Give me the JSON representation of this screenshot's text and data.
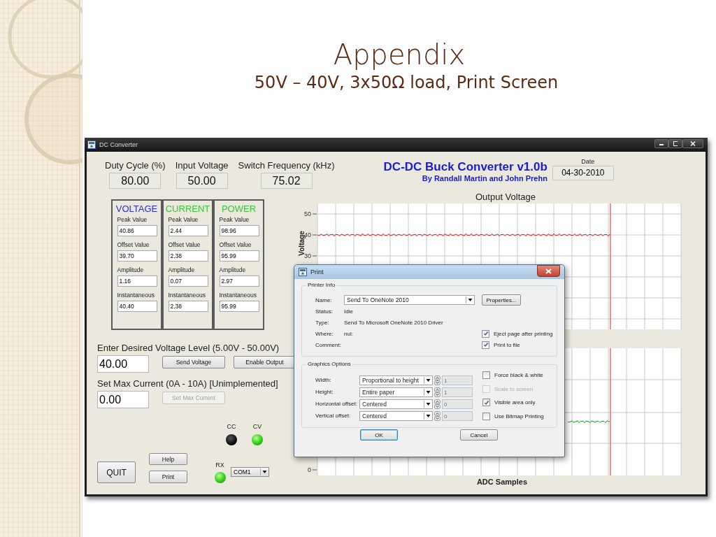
{
  "slide": {
    "title": "Appendix",
    "subtitle": "50V – 40V, 3x50Ω load, Print Screen"
  },
  "window": {
    "title": "DC Converter"
  },
  "readouts": [
    {
      "label": "Duty Cycle (%)",
      "value": "80.00"
    },
    {
      "label": "Input Voltage",
      "value": "50.00"
    },
    {
      "label": "Switch Frequency (kHz)",
      "value": "75.02"
    }
  ],
  "header": {
    "title": "DC-DC Buck Converter v1.0b",
    "authors": "By Randall Martin and John Prehn",
    "date_label": "Date",
    "date": "04-30-2010"
  },
  "groups": [
    {
      "title": "VOLTAGE",
      "color": "#2b2bd6",
      "fields": [
        {
          "label": "Peak Value",
          "value": "40.86"
        },
        {
          "label": "Offset Value",
          "value": "39.70"
        },
        {
          "label": "Amplitude",
          "value": "1.16"
        },
        {
          "label": "Instantaneous",
          "value": "40.40"
        }
      ]
    },
    {
      "title": "CURRENT",
      "color": "#3cc43c",
      "fields": [
        {
          "label": "Peak Value",
          "value": "2.44"
        },
        {
          "label": "Offset Value",
          "value": "2.38"
        },
        {
          "label": "Amplitude",
          "value": "0.07"
        },
        {
          "label": "Instantaneous",
          "value": "2.38"
        }
      ]
    },
    {
      "title": "POWER",
      "color": "#3cc43c",
      "fields": [
        {
          "label": "Peak Value",
          "value": "98.96"
        },
        {
          "label": "Offset Value",
          "value": "95.99"
        },
        {
          "label": "Amplitude",
          "value": "2.97"
        },
        {
          "label": "Instantaneous",
          "value": "95.99"
        }
      ]
    }
  ],
  "voltage_setting": {
    "label": "Enter Desired Voltage Level (5.00V - 50.00V)",
    "value": "40.00",
    "buttons": [
      {
        "label": "Send Voltage",
        "disabled": false
      },
      {
        "label": "Enable Output",
        "disabled": false
      }
    ]
  },
  "current_setting": {
    "label": "Set Max Current (0A - 10A) [Unimplemented]",
    "value": "0.00",
    "buttons": [
      {
        "label": "Set Max Current",
        "disabled": true
      }
    ]
  },
  "indicators": [
    {
      "label": "CC",
      "on": false
    },
    {
      "label": "CV",
      "on": true
    }
  ],
  "quit_button": "QUIT",
  "side_buttons": [
    "Help",
    "Print"
  ],
  "rx_indicator": {
    "label": "RX",
    "on": true
  },
  "port_select": {
    "value": "COM1"
  },
  "charts": [
    {
      "title": "Output Voltage",
      "ylabel": "Voltage",
      "y_ticks": [
        "50",
        "40",
        "30"
      ],
      "color": "#e01c1c"
    },
    {
      "xlabel": "ADC Samples",
      "y_ticks": [
        "0"
      ],
      "color": "#1a9a1a"
    }
  ],
  "print_dialog": {
    "title": "Print",
    "printer_info": {
      "title": "Printer Info",
      "name_label": "Name:",
      "name": "Send To OneNote 2010",
      "properties_button": "Properties...",
      "rows": [
        {
          "label": "Status:",
          "value": "Idle"
        },
        {
          "label": "Type:",
          "value": "Send To Microsoft OneNote 2010 Driver"
        },
        {
          "label": "Where:",
          "value": "nul:"
        },
        {
          "label": "Comment:"
        }
      ],
      "checks": [
        {
          "label": "Eject page after printing",
          "checked": true,
          "disabled": false
        },
        {
          "label": "Print to file",
          "checked": true,
          "disabled": false
        }
      ]
    },
    "graphics_options": {
      "title": "Graphics Options",
      "rows": [
        {
          "label": "Width:",
          "value": "Proportional to height",
          "spin": "1"
        },
        {
          "label": "Height:",
          "value": "Entire paper",
          "spin": "1"
        },
        {
          "label": "Horizontal offset:",
          "value": "Centered",
          "spin": "0"
        },
        {
          "label": "Vertical offset:",
          "value": "Centered",
          "spin": "0"
        }
      ],
      "checks": [
        {
          "label": "Force black & white",
          "checked": false,
          "disabled": false
        },
        {
          "label": "Scale to screen",
          "checked": false,
          "disabled": true
        },
        {
          "label": "Visible area only",
          "checked": true,
          "disabled": false
        },
        {
          "label": "Use Bitmap Printing",
          "checked": false,
          "disabled": false
        }
      ]
    },
    "buttons": [
      "OK",
      "Cancel"
    ]
  }
}
